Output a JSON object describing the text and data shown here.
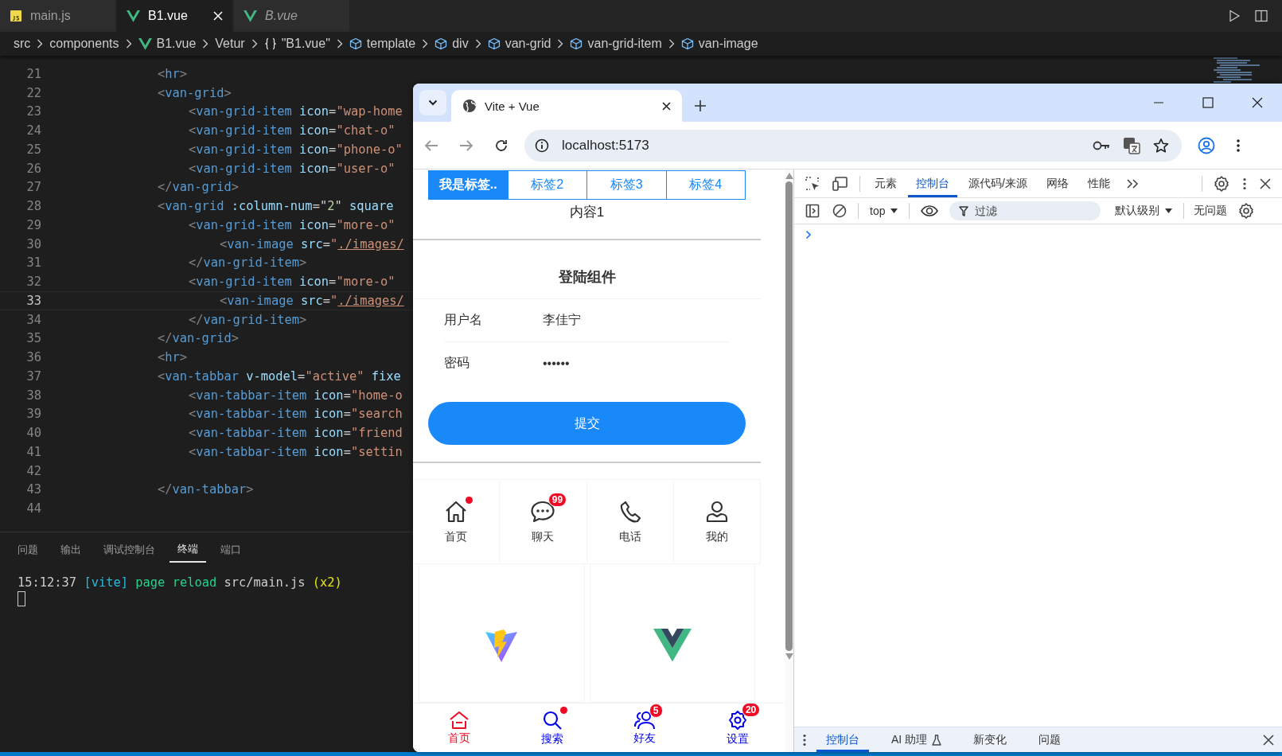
{
  "editor": {
    "tabs": [
      {
        "label": "main.js",
        "kind": "js",
        "selected": false,
        "preview": false,
        "closable": false
      },
      {
        "label": "B1.vue",
        "kind": "vue",
        "selected": true,
        "preview": false,
        "closable": true
      },
      {
        "label": "B.vue",
        "kind": "vue",
        "selected": false,
        "preview": true,
        "closable": false
      }
    ],
    "breadcrumb": [
      {
        "label": "src",
        "kind": "plain"
      },
      {
        "label": "components",
        "kind": "plain"
      },
      {
        "label": "B1.vue",
        "kind": "vue"
      },
      {
        "label": "Vetur",
        "kind": "plain"
      },
      {
        "label": "\"B1.vue\"",
        "kind": "object"
      },
      {
        "label": "template",
        "kind": "element"
      },
      {
        "label": "div",
        "kind": "element"
      },
      {
        "label": "van-grid",
        "kind": "element"
      },
      {
        "label": "van-grid-item",
        "kind": "element"
      },
      {
        "label": "van-image",
        "kind": "element"
      }
    ],
    "lines": [
      {
        "n": "21",
        "current": false,
        "tokens": [
          {
            "kind": "punct",
            "text": "<"
          },
          {
            "kind": "tag",
            "text": "hr"
          },
          {
            "kind": "punct",
            "text": ">"
          }
        ]
      },
      {
        "n": "22",
        "current": false,
        "tokens": [
          {
            "kind": "punct",
            "text": "<"
          },
          {
            "kind": "tag",
            "text": "van-grid"
          },
          {
            "kind": "punct",
            "text": ">"
          }
        ],
        "children": [
          {
            "n": "23",
            "current": false,
            "tokens": [
              {
                "kind": "punct",
                "text": "<"
              },
              {
                "kind": "tag",
                "text": "van-grid-item "
              },
              {
                "kind": "attr",
                "text": "icon"
              },
              {
                "kind": "plain",
                "text": "="
              },
              {
                "kind": "string",
                "text": "\"wap-home"
              }
            ]
          },
          {
            "n": "24",
            "current": false,
            "tokens": [
              {
                "kind": "punct",
                "text": "<"
              },
              {
                "kind": "tag",
                "text": "van-grid-item "
              },
              {
                "kind": "attr",
                "text": "icon"
              },
              {
                "kind": "plain",
                "text": "="
              },
              {
                "kind": "string",
                "text": "\"chat-o\""
              }
            ]
          },
          {
            "n": "25",
            "current": false,
            "tokens": [
              {
                "kind": "punct",
                "text": "<"
              },
              {
                "kind": "tag",
                "text": "van-grid-item "
              },
              {
                "kind": "attr",
                "text": "icon"
              },
              {
                "kind": "plain",
                "text": "="
              },
              {
                "kind": "string",
                "text": "\"phone-o\""
              }
            ]
          },
          {
            "n": "26",
            "current": false,
            "tokens": [
              {
                "kind": "punct",
                "text": "<"
              },
              {
                "kind": "tag",
                "text": "van-grid-item "
              },
              {
                "kind": "attr",
                "text": "icon"
              },
              {
                "kind": "plain",
                "text": "="
              },
              {
                "kind": "string",
                "text": "\"user-o\""
              }
            ]
          }
        ]
      },
      {
        "n": "27",
        "current": false,
        "tokens": [
          {
            "kind": "punct",
            "text": "</"
          },
          {
            "kind": "tag",
            "text": "van-grid"
          },
          {
            "kind": "punct",
            "text": ">"
          }
        ]
      },
      {
        "n": "28",
        "current": false,
        "tokens": [
          {
            "kind": "punct",
            "text": "<"
          },
          {
            "kind": "tag",
            "text": "van-grid "
          },
          {
            "kind": "attr",
            "text": ":column-num"
          },
          {
            "kind": "plain",
            "text": "=\""
          },
          {
            "kind": "number",
            "text": "2"
          },
          {
            "kind": "plain",
            "text": "\" "
          },
          {
            "kind": "attr",
            "text": "square"
          }
        ],
        "children": [
          {
            "n": "29",
            "current": false,
            "tokens": [
              {
                "kind": "punct",
                "text": "<"
              },
              {
                "kind": "tag",
                "text": "van-grid-item "
              },
              {
                "kind": "attr",
                "text": "icon"
              },
              {
                "kind": "plain",
                "text": "="
              },
              {
                "kind": "string",
                "text": "\"more-o\""
              }
            ],
            "children": [
              {
                "n": "30",
                "current": false,
                "tokens": [
                  {
                    "kind": "punct",
                    "text": "<"
                  },
                  {
                    "kind": "tag",
                    "text": "van-image "
                  },
                  {
                    "kind": "attr",
                    "text": "src"
                  },
                  {
                    "kind": "plain",
                    "text": "="
                  },
                  {
                    "kind": "string",
                    "text": "\""
                  },
                  {
                    "kind": "link",
                    "text": "./images/"
                  }
                ]
              }
            ]
          },
          {
            "n": "31",
            "current": false,
            "tokens": [
              {
                "kind": "punct",
                "text": "</"
              },
              {
                "kind": "tag",
                "text": "van-grid-item"
              },
              {
                "kind": "punct",
                "text": ">"
              }
            ]
          },
          {
            "n": "32",
            "current": false,
            "tokens": [
              {
                "kind": "punct",
                "text": "<"
              },
              {
                "kind": "tag",
                "text": "van-grid-item "
              },
              {
                "kind": "attr",
                "text": "icon"
              },
              {
                "kind": "plain",
                "text": "="
              },
              {
                "kind": "string",
                "text": "\"more-o\""
              }
            ],
            "children": [
              {
                "n": "33",
                "current": true,
                "tokens": [
                  {
                    "kind": "punct",
                    "text": "<"
                  },
                  {
                    "kind": "tag",
                    "text": "van-image "
                  },
                  {
                    "kind": "attr",
                    "text": "src"
                  },
                  {
                    "kind": "plain",
                    "text": "="
                  },
                  {
                    "kind": "string",
                    "text": "\""
                  },
                  {
                    "kind": "link",
                    "text": "./images/"
                  }
                ]
              }
            ]
          },
          {
            "n": "34",
            "current": false,
            "tokens": [
              {
                "kind": "punct",
                "text": "</"
              },
              {
                "kind": "tag",
                "text": "van-grid-item"
              },
              {
                "kind": "punct",
                "text": ">"
              }
            ]
          }
        ]
      },
      {
        "n": "35",
        "current": false,
        "tokens": [
          {
            "kind": "punct",
            "text": "</"
          },
          {
            "kind": "tag",
            "text": "van-grid"
          },
          {
            "kind": "punct",
            "text": ">"
          }
        ]
      },
      {
        "n": "36",
        "current": false,
        "tokens": [
          {
            "kind": "punct",
            "text": "<"
          },
          {
            "kind": "tag",
            "text": "hr"
          },
          {
            "kind": "punct",
            "text": ">"
          }
        ]
      },
      {
        "n": "37",
        "current": false,
        "tokens": [
          {
            "kind": "punct",
            "text": "<"
          },
          {
            "kind": "tag",
            "text": "van-tabbar "
          },
          {
            "kind": "attr",
            "text": "v-model"
          },
          {
            "kind": "plain",
            "text": "="
          },
          {
            "kind": "string",
            "text": "\"active\" "
          },
          {
            "kind": "attr",
            "text": "fixe"
          }
        ],
        "children": [
          {
            "n": "38",
            "current": false,
            "tokens": [
              {
                "kind": "punct",
                "text": "<"
              },
              {
                "kind": "tag",
                "text": "van-tabbar-item "
              },
              {
                "kind": "attr",
                "text": "icon"
              },
              {
                "kind": "plain",
                "text": "="
              },
              {
                "kind": "string",
                "text": "\"home-o"
              }
            ]
          },
          {
            "n": "39",
            "current": false,
            "tokens": [
              {
                "kind": "punct",
                "text": "<"
              },
              {
                "kind": "tag",
                "text": "van-tabbar-item "
              },
              {
                "kind": "attr",
                "text": "icon"
              },
              {
                "kind": "plain",
                "text": "="
              },
              {
                "kind": "string",
                "text": "\"search"
              }
            ]
          },
          {
            "n": "40",
            "current": false,
            "tokens": [
              {
                "kind": "punct",
                "text": "<"
              },
              {
                "kind": "tag",
                "text": "van-tabbar-item "
              },
              {
                "kind": "attr",
                "text": "icon"
              },
              {
                "kind": "plain",
                "text": "="
              },
              {
                "kind": "string",
                "text": "\"friend"
              }
            ]
          },
          {
            "n": "41",
            "current": false,
            "tokens": [
              {
                "kind": "punct",
                "text": "<"
              },
              {
                "kind": "tag",
                "text": "van-tabbar-item "
              },
              {
                "kind": "attr",
                "text": "icon"
              },
              {
                "kind": "plain",
                "text": "="
              },
              {
                "kind": "string",
                "text": "\"settin"
              }
            ]
          },
          {
            "n": "42",
            "current": false
          }
        ]
      },
      {
        "n": "43",
        "current": false,
        "tokens": [
          {
            "kind": "punct",
            "text": "</"
          },
          {
            "kind": "tag",
            "text": "van-tabbar"
          },
          {
            "kind": "punct",
            "text": ">"
          }
        ]
      },
      {
        "n": "44",
        "current": false
      }
    ],
    "panel_tabs": [
      {
        "label": "问题",
        "selected": false
      },
      {
        "label": "输出",
        "selected": false
      },
      {
        "label": "调试控制台",
        "selected": false
      },
      {
        "label": "终端",
        "selected": true
      },
      {
        "label": "端口",
        "selected": false
      }
    ],
    "terminal": [
      {
        "kind": "time",
        "text": "15:12:37"
      },
      {
        "kind": "tag",
        "text": "[vite]"
      },
      {
        "kind": "ok",
        "text": "page reload"
      },
      {
        "kind": "path",
        "text": "src/main.js"
      },
      {
        "kind": "count",
        "text": "(x2)"
      }
    ]
  },
  "browser": {
    "tab_title": "Vite + Vue",
    "url": "localhost:5173",
    "page": {
      "tabs": [
        {
          "label": "我是标签..",
          "selected": true
        },
        {
          "label": "标签2",
          "selected": false
        },
        {
          "label": "标签3",
          "selected": false
        },
        {
          "label": "标签4",
          "selected": false
        }
      ],
      "content": "内容1",
      "form": {
        "title": "登陆组件",
        "fields": [
          {
            "label": "用户名",
            "value": "李佳宁"
          },
          {
            "label": "密码",
            "value": "••••••"
          }
        ],
        "submit": "提交"
      },
      "grid": [
        {
          "label": "首页",
          "dot": true
        },
        {
          "label": "聊天",
          "badge": "99"
        },
        {
          "label": "电话",
          "dot": false
        },
        {
          "label": "我的",
          "dot": false
        }
      ],
      "tabbar": [
        {
          "label": "首页",
          "selected": true,
          "dot": false
        },
        {
          "label": "搜索",
          "selected": false,
          "dot": true
        },
        {
          "label": "好友",
          "selected": false,
          "badge": "5"
        },
        {
          "label": "设置",
          "selected": false,
          "badge": "20"
        }
      ]
    },
    "devtools": {
      "tabs": [
        {
          "label": "元素",
          "selected": false
        },
        {
          "label": "控制台",
          "selected": true
        },
        {
          "label": "源代码/来源",
          "selected": false
        },
        {
          "label": "网络",
          "selected": false
        },
        {
          "label": "性能",
          "selected": false
        }
      ],
      "context": "top",
      "filter_placeholder": "过滤",
      "log_level": "默认级别",
      "issues": "无问题",
      "drawer_tabs": [
        {
          "label": "控制台",
          "selected": true,
          "experimental": false
        },
        {
          "label": "AI 助理",
          "selected": false,
          "experimental": true
        },
        {
          "label": "新变化",
          "selected": false,
          "experimental": false
        },
        {
          "label": "问题",
          "selected": false,
          "experimental": false
        }
      ]
    }
  }
}
